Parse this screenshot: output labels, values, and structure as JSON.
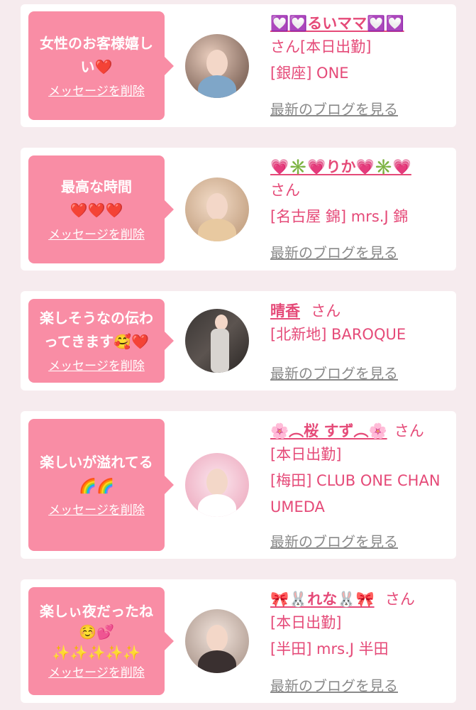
{
  "delete_label": "メッセージを削除",
  "blog_label": "最新のブログを見る",
  "colors": {
    "bubble": "#f98da5",
    "accent": "#e54a78",
    "muted": "#8a8a8a"
  },
  "cards": [
    {
      "message": "女性のお客様嬉しい❤️",
      "name": "💟💟るいママ💟💟",
      "suffix": "さん",
      "status": "[本日出勤]",
      "shop": "[銀座] ONE"
    },
    {
      "message": "最高な時間\n❤️❤️❤️",
      "name": "💗✳️💗りか💗✳️💗",
      "suffix": "さん",
      "status": "",
      "shop": "[名古屋 錦] mrs.J 錦"
    },
    {
      "message": "楽しそうなの伝わってきます🥰❤️",
      "name": "晴香",
      "suffix": "さん",
      "status": "",
      "shop": "[北新地] BAROQUE"
    },
    {
      "message": "楽しいが溢れてる\n🌈🌈",
      "name": "🌸︵桜 すず︵🌸",
      "suffix": "さん",
      "status": "[本日出勤]",
      "shop": "[梅田] CLUB ONE CHAN UMEDA"
    },
    {
      "message": "楽しぃ夜だったね\n☺️💕\n✨✨✨✨✨",
      "name": "🎀🐰れな🐰🎀",
      "suffix": "さん",
      "status": "[本日出勤]",
      "shop": "[半田] mrs.J 半田"
    }
  ]
}
